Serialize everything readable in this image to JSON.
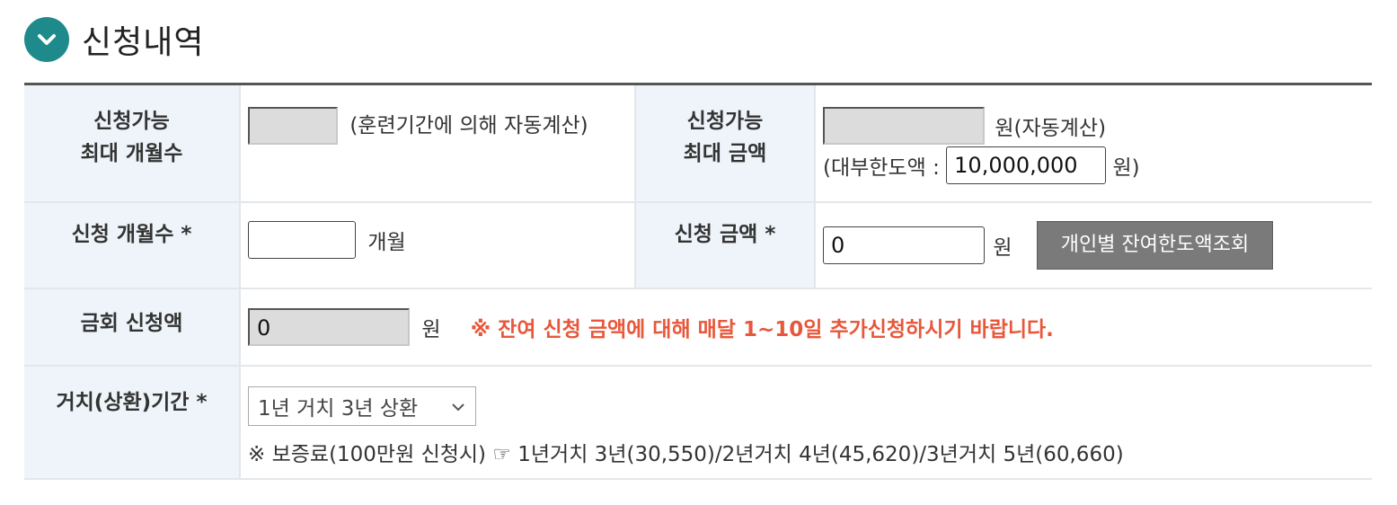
{
  "section": {
    "title": "신청내역",
    "toggle_icon": "chevron-down-icon",
    "accent": "#1f8a8c"
  },
  "rows": {
    "max_months": {
      "label_line1": "신청가능",
      "label_line2": "최대 개월수",
      "value": "",
      "note": "(훈련기간에 의해 자동계산)"
    },
    "max_amount": {
      "label_line1": "신청가능",
      "label_line2": "최대 금액",
      "value": "",
      "unit_note": "원(자동계산)",
      "limit_prefix": "(대부한도액 :",
      "limit_value": "10,000,000",
      "limit_suffix": "원)"
    },
    "apply_months": {
      "label": "신청 개월수",
      "required_mark": "*",
      "value": "",
      "unit": "개월"
    },
    "apply_amount": {
      "label": "신청 금액",
      "required_mark": "*",
      "value": "0",
      "unit": "원",
      "button_label": "개인별 잔여한도액조회"
    },
    "this_time_amount": {
      "label": "금회 신청액",
      "value": "0",
      "unit": "원",
      "warning": "※ 잔여 신청 금액에 대해 매달 1~10일 추가신청하시기 바랍니다."
    },
    "grace_period": {
      "label": "거치(상환)기간",
      "required_mark": "*",
      "selected": "1년 거치 3년 상환",
      "note": "※ 보증료(100만원 신청시) ☞ 1년거치 3년(30,550)/2년거치 4년(45,620)/3년거치 5년(60,660)"
    }
  },
  "colors": {
    "label_bg": "#eef4f9",
    "warning": "#e8573a",
    "button_bg": "#7a7a7a"
  }
}
